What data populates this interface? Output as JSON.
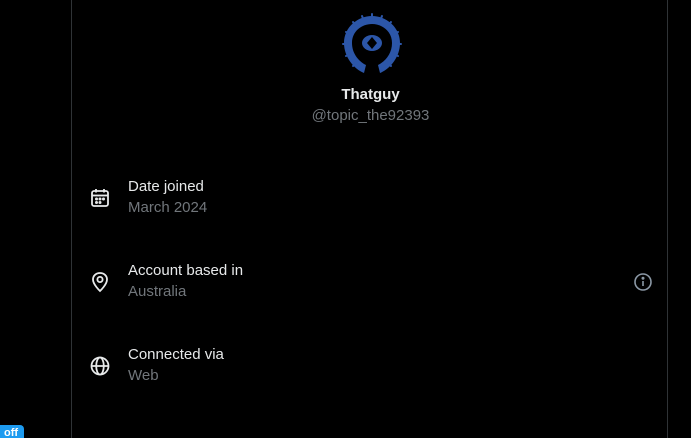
{
  "profile": {
    "display_name": "Thatguy",
    "handle": "@topic_the92393"
  },
  "about": {
    "rows": [
      {
        "label": "Date joined",
        "value": "March 2024",
        "icon": "calendar-icon"
      },
      {
        "label": "Account based in",
        "value": "Australia",
        "icon": "location-pin-icon"
      },
      {
        "label": "Connected via",
        "value": "Web",
        "icon": "globe-icon"
      }
    ],
    "info_icon": "info-circle-icon"
  },
  "overlay": {
    "badge_label": "off"
  },
  "colors": {
    "background": "#000000",
    "primary_text": "#e7e9ea",
    "secondary_text": "#71767b",
    "accent": "#1d9bf0",
    "avatar_blue": "#2c56a8"
  }
}
